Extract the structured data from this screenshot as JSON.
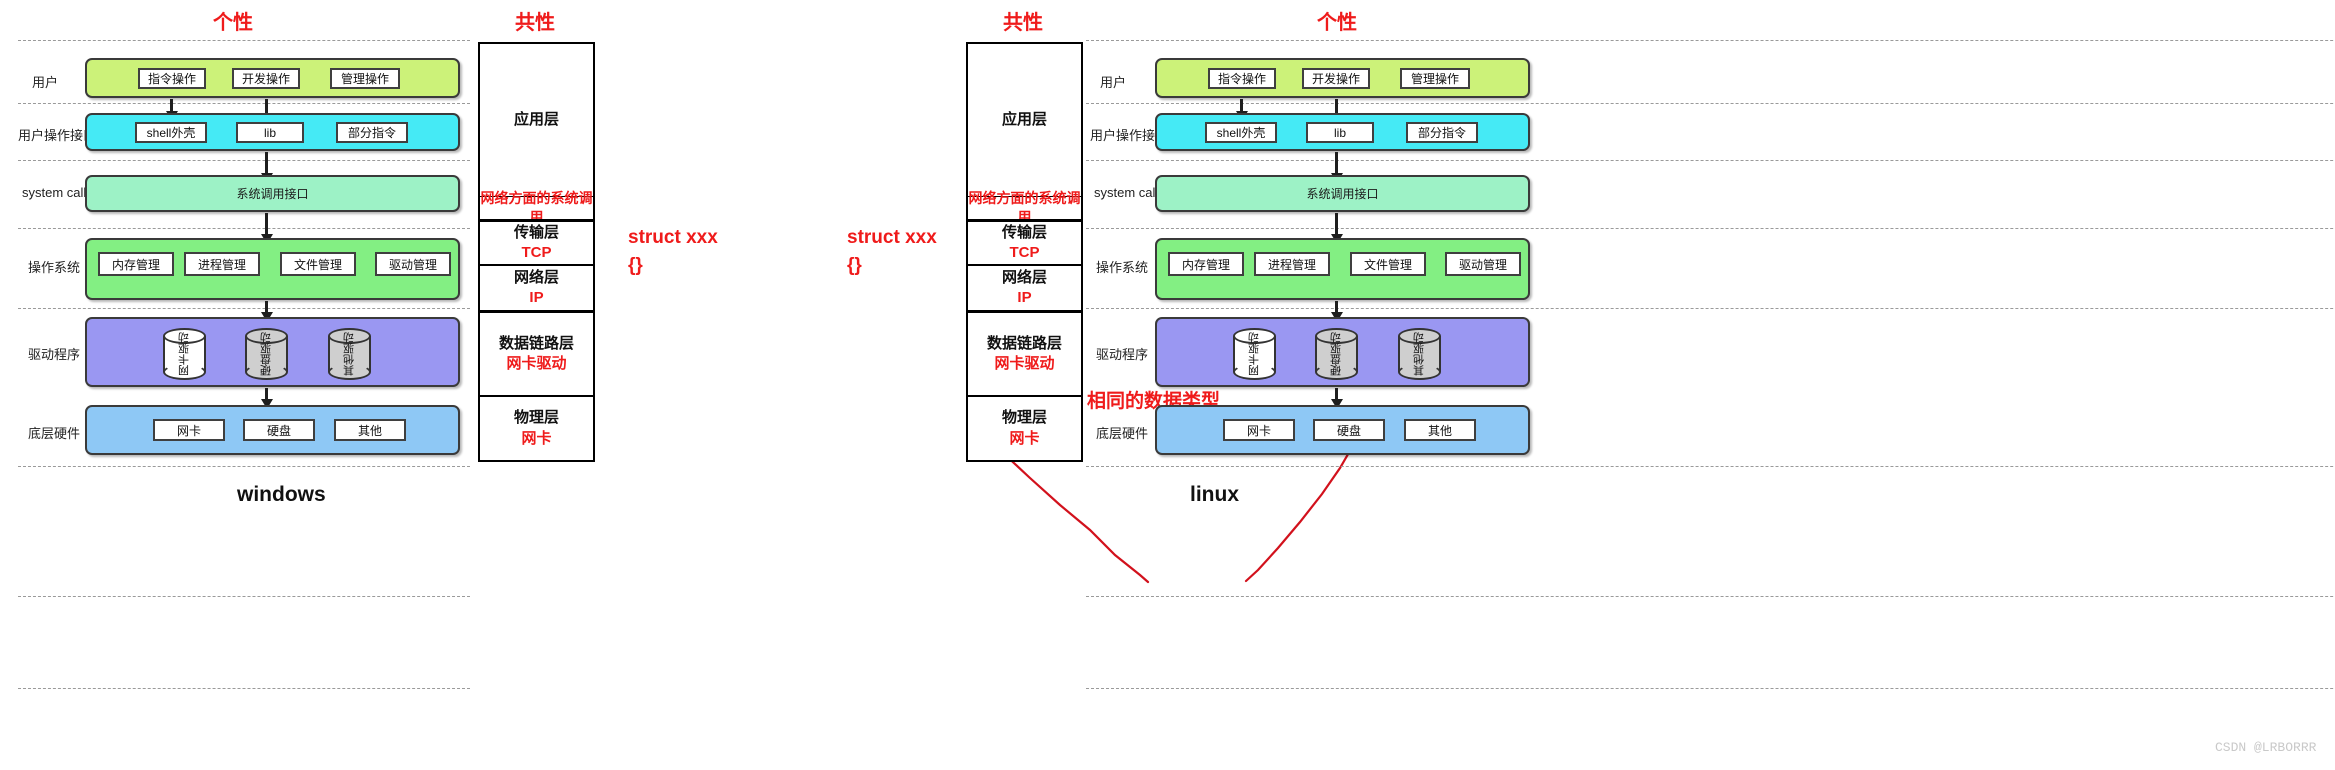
{
  "headings": {
    "left_personality": "个性",
    "left_commonality": "共性",
    "right_commonality": "共性",
    "right_personality": "个性"
  },
  "row_labels": {
    "user": "用户",
    "user_interface": "用户操作接口",
    "system_call": "system call",
    "operating_system": "操作系统",
    "driver": "驱动程序",
    "hardware": "底层硬件"
  },
  "stack": {
    "user_chips": [
      "指令操作",
      "开发操作",
      "管理操作"
    ],
    "interface_chips": [
      "shell外壳",
      "lib",
      "部分指令"
    ],
    "syscall_label": "系统调用接口",
    "os_chips": [
      "内存管理",
      "进程管理",
      "文件管理",
      "驱动管理"
    ],
    "driver_cylinders": [
      "网卡驱动",
      "硬盘驱动",
      "其他驱动"
    ],
    "hardware_chips": [
      "网卡",
      "硬盘",
      "其他"
    ]
  },
  "osi": {
    "application": {
      "name": "应用层"
    },
    "network_syscall": {
      "name": "网络方面的系统调用"
    },
    "transport": {
      "name": "传输层",
      "proto": "TCP"
    },
    "network": {
      "name": "网络层",
      "proto": "IP"
    },
    "datalink": {
      "name": "数据链路层",
      "proto": "网卡驱动"
    },
    "physical": {
      "name": "物理层",
      "proto": "网卡"
    }
  },
  "annotation": {
    "struct_left_line1": "struct xxx",
    "struct_left_line2": "{}",
    "struct_right_line1": "struct xxx",
    "struct_right_line2": "{}",
    "same_data_type": "相同的数据类型"
  },
  "os_names": {
    "left": "windows",
    "right": "linux"
  },
  "watermark": "CSDN @LRBORRR",
  "colors": {
    "accent_red": "#ef1b1b",
    "band_user": "#ccf279",
    "band_interface": "#45eaf5",
    "band_syscall": "#9df2c6",
    "band_os": "#83ef83",
    "band_driver": "#9a97f2",
    "band_hardware": "#8ec8f5"
  }
}
